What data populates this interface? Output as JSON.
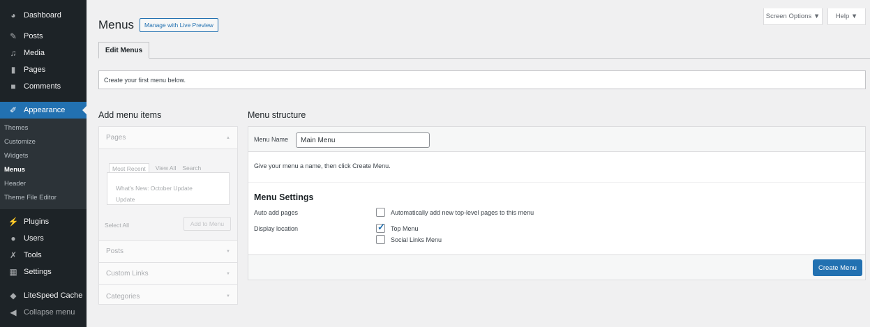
{
  "sidebar": {
    "items": [
      {
        "label": "Dashboard",
        "icon": "dashboard-icon"
      },
      {
        "label": "Posts",
        "icon": "pin-icon"
      },
      {
        "label": "Media",
        "icon": "media-icon"
      },
      {
        "label": "Pages",
        "icon": "pages-icon"
      },
      {
        "label": "Comments",
        "icon": "comments-icon"
      },
      {
        "label": "Appearance",
        "icon": "brush-icon"
      },
      {
        "label": "Plugins",
        "icon": "plug-icon"
      },
      {
        "label": "Users",
        "icon": "users-icon"
      },
      {
        "label": "Tools",
        "icon": "wrench-icon"
      },
      {
        "label": "Settings",
        "icon": "settings-icon"
      },
      {
        "label": "LiteSpeed Cache",
        "icon": "litespeed-icon"
      },
      {
        "label": "Collapse menu",
        "icon": "collapse-icon"
      }
    ],
    "submenu": [
      "Themes",
      "Customize",
      "Widgets",
      "Menus",
      "Header",
      "Theme File Editor"
    ]
  },
  "screen_meta": {
    "screen_options": "Screen Options ▼",
    "help": "Help ▼"
  },
  "page": {
    "title": "Menus",
    "live_preview": "Manage with Live Preview",
    "tab": "Edit Menus",
    "notice": "Create your first menu below."
  },
  "add_items": {
    "heading": "Add menu items",
    "pages_label": "Pages",
    "tabs": [
      "Most Recent",
      "View All",
      "Search"
    ],
    "page_item": "What's New: October Update Update",
    "select_all": "Select All",
    "add_button": "Add to Menu",
    "sections": [
      "Posts",
      "Custom Links",
      "Categories"
    ]
  },
  "structure": {
    "heading": "Menu structure",
    "name_label": "Menu Name",
    "name_value": "Main Menu",
    "hint": "Give your menu a name, then click Create Menu.",
    "settings_title": "Menu Settings",
    "auto_add_label": "Auto add pages",
    "auto_add_option": "Automatically add new top-level pages to this menu",
    "display_label": "Display location",
    "locations": [
      {
        "label": "Top Menu",
        "checked": true
      },
      {
        "label": "Social Links Menu",
        "checked": false
      }
    ],
    "create_button": "Create Menu"
  },
  "colors": {
    "accent": "#2271b1",
    "sidebar_bg": "#1d2327",
    "submenu_bg": "#2c3338"
  }
}
